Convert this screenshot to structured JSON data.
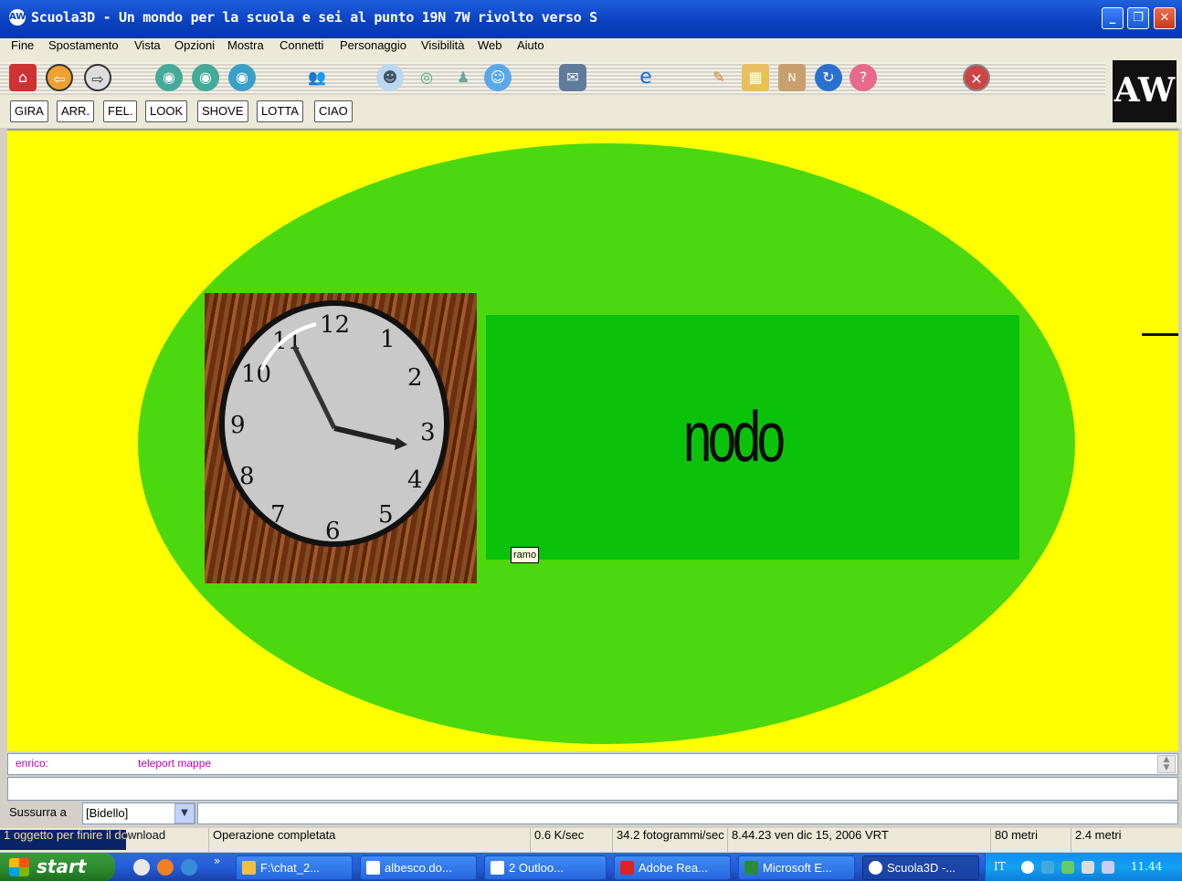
{
  "window": {
    "title": "Scuola3D - Un mondo per la scuola e sei al punto 19N 7W rivolto verso S",
    "controls": {
      "minimize": "_",
      "restore": "❐",
      "close": "✕"
    }
  },
  "menu": [
    "Fine",
    "Spostamento",
    "Vista",
    "Opzioni",
    "Mostra",
    "Connetti",
    "Personaggio",
    "Visibilità",
    "Web",
    "Aiuto"
  ],
  "toolbar": {
    "icons": [
      "home-icon",
      "back-icon",
      "forward-icon",
      "eye-icon",
      "eye-look-icon",
      "eye-aside-icon",
      "people-icon",
      "avatar-icon",
      "avatar-visibility-icon",
      "avatar-single-icon",
      "avatar-group-icon",
      "chat-icon",
      "browser-icon",
      "tools-icon",
      "map-icon",
      "compass-icon",
      "refresh-icon",
      "help-icon",
      "stop-icon"
    ],
    "commands": [
      "GIRA",
      "ARR.",
      "FEL.",
      "LOOK",
      "SHOVE",
      "LOTTA",
      "CIAO"
    ]
  },
  "scene": {
    "sign_text": "nodo",
    "label": "ramo",
    "clock_numbers": [
      "12",
      "1",
      "2",
      "3",
      "4",
      "5",
      "6",
      "7",
      "8",
      "9",
      "10",
      "11"
    ],
    "colors": {
      "sky": "#ffff00",
      "ground": "#4cd80e",
      "sign": "#0ac20a"
    }
  },
  "chat": {
    "sender": "enrico:",
    "message": "teleport mappe",
    "whisper_label": "Sussurra a",
    "whisper_target": "[Bidello]"
  },
  "status": {
    "download": "1 oggetto per finire il download",
    "operation": "Operazione completata",
    "speed": "0.6 K/sec",
    "fps": "34.2 fotogrammi/sec",
    "datetime": "8.44.23 ven dic 15, 2006 VRT",
    "distance": "80 metri",
    "height": "2.4 metri"
  },
  "taskbar": {
    "start": "start",
    "more": "»",
    "buttons": [
      "F:\\chat_2...",
      "albesco.do...",
      "2 Outloo...",
      "Adobe Rea...",
      "Microsoft E...",
      "Scuola3D -..."
    ],
    "lang": "IT",
    "clock": "11.44"
  }
}
